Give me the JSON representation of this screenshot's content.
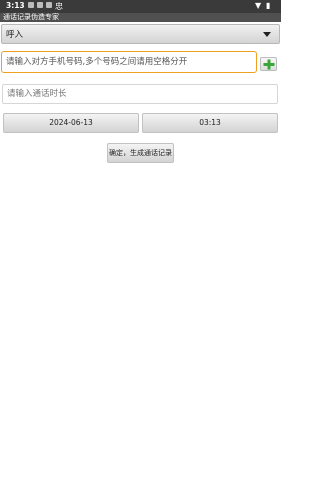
{
  "status_bar": {
    "time": "3:13",
    "icons": [
      "notification-icon",
      "notification-icon",
      "notification-icon",
      "app-icon",
      "wifi-icon",
      "battery-icon"
    ]
  },
  "app": {
    "title": "通话记录伪造专家"
  },
  "call_type": {
    "selected": "呼入"
  },
  "phone_input": {
    "value": "",
    "placeholder": "请输入对方手机号码,多个号码之间请用空格分开"
  },
  "duration_input": {
    "value": "",
    "placeholder": "请输入通话时长"
  },
  "date_button": {
    "label": "2024-06-13"
  },
  "time_button": {
    "label": "03:13"
  },
  "generate_button": {
    "label": "确定，生成通话记录"
  },
  "colors": {
    "status_bar": "#3a3a3a",
    "title_bar": "#505050",
    "focus_border": "#f0a020",
    "add_icon": "#3aa63a"
  }
}
